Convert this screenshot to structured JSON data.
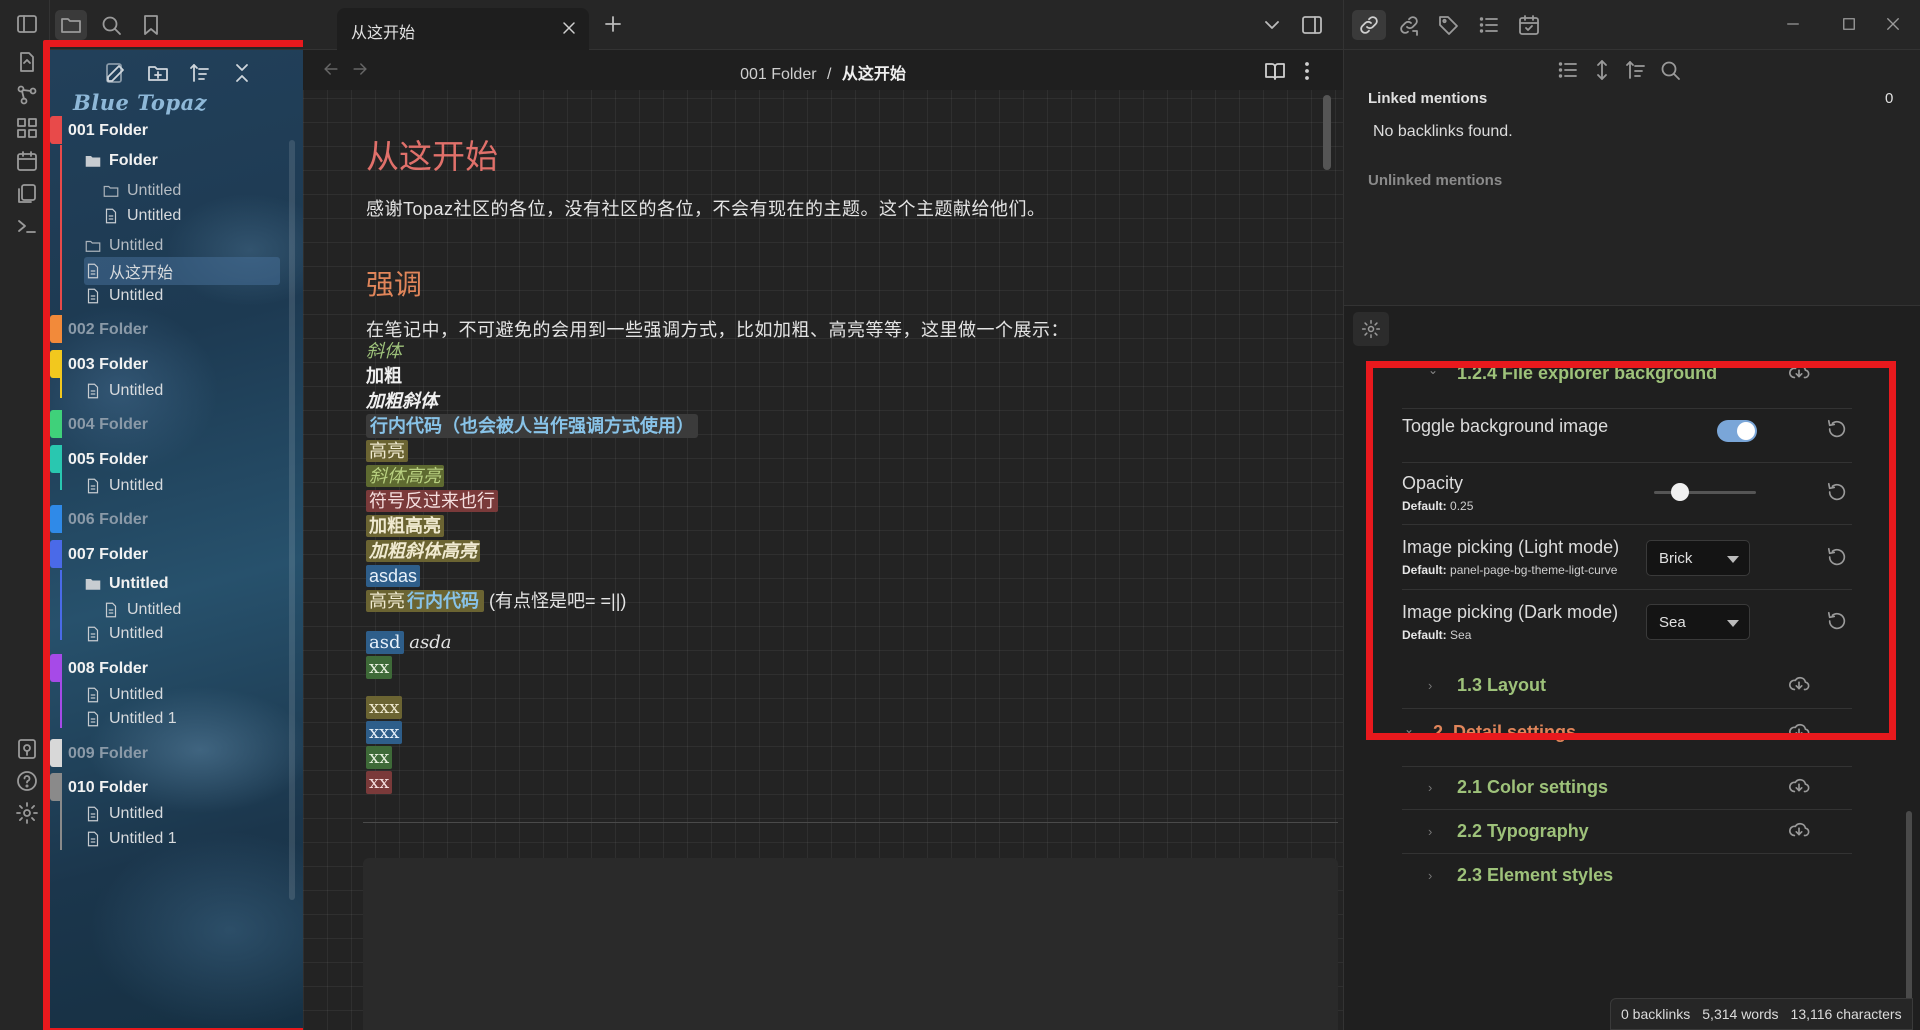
{
  "explorer": {
    "brand": "Blue Topaz",
    "items": [
      {
        "label": "001 Folder",
        "type": "folder"
      },
      {
        "label": "Folder",
        "type": "subfolder"
      },
      {
        "label": "Untitled",
        "type": "empty-folder"
      },
      {
        "label": "Untitled",
        "type": "file"
      },
      {
        "label": "Untitled",
        "type": "empty-folder"
      },
      {
        "label": "从这开始",
        "type": "file"
      },
      {
        "label": "Untitled",
        "type": "file"
      },
      {
        "label": "002 Folder",
        "type": "folder"
      },
      {
        "label": "003 Folder",
        "type": "folder"
      },
      {
        "label": "Untitled",
        "type": "file"
      },
      {
        "label": "004 Folder",
        "type": "folder"
      },
      {
        "label": "005 Folder",
        "type": "folder"
      },
      {
        "label": "Untitled",
        "type": "file"
      },
      {
        "label": "006 Folder",
        "type": "folder"
      },
      {
        "label": "007 Folder",
        "type": "folder"
      },
      {
        "label": "Untitled",
        "type": "subfolder"
      },
      {
        "label": "Untitled",
        "type": "file"
      },
      {
        "label": "Untitled",
        "type": "file"
      },
      {
        "label": "008 Folder",
        "type": "folder"
      },
      {
        "label": "Untitled",
        "type": "file"
      },
      {
        "label": "Untitled 1",
        "type": "file"
      },
      {
        "label": "009 Folder",
        "type": "folder"
      },
      {
        "label": "010 Folder",
        "type": "folder"
      },
      {
        "label": "Untitled",
        "type": "file"
      },
      {
        "label": "Untitled 1",
        "type": "file"
      }
    ],
    "folder_colors": [
      "#e84a4a",
      "#f28a3a",
      "#f2c81e",
      "#3fd17a",
      "#29c7b0",
      "#2f8ae8",
      "#4a6ae8",
      "#a64ae8",
      "#d8d8d8",
      "#8a8a8a"
    ]
  },
  "tab": {
    "title": "从这开始"
  },
  "breadcrumb": {
    "folder": "001 Folder",
    "separator": "/",
    "note": "从这开始"
  },
  "note": {
    "h1": "从这开始",
    "intro": "感谢Topaz社区的各位，没有社区的各位，不会有现在的主题。这个主题献给他们。",
    "h2": "强调",
    "para": "在笔记中，不可避免的会用到一些强调方式，比如加粗、高亮等等，这里做一个展示：",
    "italic": "斜体",
    "bold": "加粗",
    "bold_italic": "加粗斜体",
    "inline_code": "行内代码（也会被人当作强调方式使用）",
    "highlight": "高亮",
    "italic_highlight": "斜体高亮",
    "reversed": "符号反过来也行",
    "bold_highlight": "加粗高亮",
    "bold_italic_highlight": "加粗斜体高亮",
    "asdas": "asdas",
    "hl_prefix": "高亮",
    "hl_code": "行内代码",
    "hl_suffix": "(有点怪是吧= =||)",
    "asd": "asd",
    "asda": "asda",
    "xx1": "xx",
    "xxx1": "xxx",
    "xxx2": "xxx",
    "xx2": "xx",
    "xx3": "xx"
  },
  "backlinks": {
    "linked_label": "Linked mentions",
    "linked_count": "0",
    "empty": "No backlinks found.",
    "unlinked_label": "Unlinked mentions"
  },
  "settings": {
    "section": "1.2.4 File explorer background",
    "toggle": {
      "name": "Toggle background image",
      "on": true
    },
    "opacity": {
      "name": "Opacity",
      "default_label": "Default:",
      "default_value": "0.25",
      "value": 0.25
    },
    "light": {
      "name": "Image picking (Light mode)",
      "default_label": "Default:",
      "default_value": "panel-page-bg-theme-ligt-curve",
      "selected": "Brick"
    },
    "dark": {
      "name": "Image picking (Dark mode)",
      "default_label": "Default:",
      "default_value": "Sea",
      "selected": "Sea"
    },
    "layout": "1.3 Layout",
    "detail": "2. Detail settings",
    "color": "2.1 Color settings",
    "typography": "2.2 Typography",
    "element": "2.3 Element styles"
  },
  "status": {
    "backlinks": "0 backlinks",
    "words": "5,314 words",
    "chars": "13,116 characters"
  },
  "colors": {
    "accent_green": "#9ec27a",
    "accent_orange": "#e0855a",
    "highlight_red": "#e8191d",
    "toggle_on": "#7aa6d8"
  }
}
